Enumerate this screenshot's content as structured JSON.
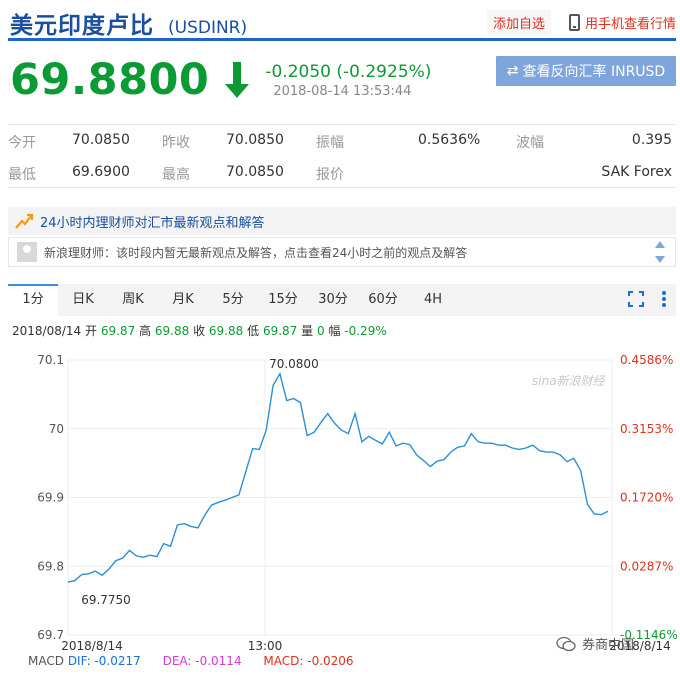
{
  "header": {
    "pair_name": "美元印度卢比",
    "pair_code": "(USDINR)",
    "add_favorite": "添加自选",
    "mobile_view": "用手机查看行情"
  },
  "quote": {
    "price": "69.8800",
    "change": "-0.2050 (-0.2925%)",
    "time": "2018-08-14 13:53:44",
    "reverse_button": "查看反向汇率 INRUSD",
    "colors": {
      "down": "#0c9a34",
      "up": "#e0301e",
      "brand": "#1a4ea0"
    }
  },
  "stats": {
    "row1": [
      {
        "label": "今开",
        "value": "70.0850"
      },
      {
        "label": "昨收",
        "value": "70.0850"
      },
      {
        "label": "振幅",
        "value": "0.5636%"
      },
      {
        "label": "波幅",
        "value": "0.395"
      }
    ],
    "row2": [
      {
        "label": "最低",
        "value": "69.6900"
      },
      {
        "label": "最高",
        "value": "70.0850"
      },
      {
        "label": "报价",
        "value": ""
      },
      {
        "label": "",
        "value": "SAK Forex"
      }
    ]
  },
  "expert": {
    "title": "24小时内理财师对汇市最新观点和解答",
    "message": "新浪理财师：该时段内暂无最新观点及解答，点击查看24小时之前的观点及解答"
  },
  "tabs": [
    "1分",
    "日K",
    "周K",
    "月K",
    "5分",
    "15分",
    "30分",
    "60分",
    "4H"
  ],
  "active_tab": "1分",
  "ohlc": {
    "date": "2018/08/14",
    "open_label": "开",
    "open": "69.87",
    "high_label": "高",
    "high": "69.88",
    "close_label": "收",
    "close": "69.88",
    "low_label": "低",
    "low": "69.87",
    "volume_label": "量",
    "volume": "0",
    "amp_label": "幅",
    "amp": "-0.29%"
  },
  "watermark": "sina新浪财经",
  "wechat_label": "券商中国",
  "macd": {
    "label": "MACD",
    "dif": "DIF: -0.0217",
    "dea": "DEA: -0.0114",
    "macd": "MACD: -0.0206"
  },
  "chart_data": {
    "type": "line",
    "x_ticks": [
      "2018/8/14",
      "13:00",
      "2018/8/14"
    ],
    "y_ticks": [
      "70.1",
      "70",
      "69.9",
      "69.8",
      "69.7"
    ],
    "pct_ticks": [
      "0.4586%",
      "0.3153%",
      "0.1720%",
      "0.0287%",
      "-0.1146%"
    ],
    "ylim": [
      69.7,
      70.1
    ],
    "annotations": [
      {
        "text": "70.0800",
        "index": 31
      },
      {
        "text": "69.7750",
        "index": 0
      }
    ],
    "grid": true,
    "series": [
      {
        "values": [
          69.777,
          69.779,
          69.788,
          69.789,
          69.793,
          69.787,
          69.796,
          69.808,
          69.812,
          69.823,
          69.815,
          69.813,
          69.816,
          69.814,
          69.833,
          69.829,
          69.86,
          69.862,
          69.858,
          69.856,
          69.874,
          69.889,
          69.893,
          69.896,
          69.9,
          69.904,
          69.937,
          69.971,
          69.97,
          69.998,
          70.063,
          70.08,
          70.041,
          70.044,
          70.038,
          69.99,
          69.995,
          70.009,
          70.022,
          70.008,
          69.998,
          69.993,
          70.022,
          69.981,
          69.989,
          69.983,
          69.978,
          69.995,
          69.975,
          69.979,
          69.977,
          69.962,
          69.954,
          69.945,
          69.953,
          69.955,
          69.966,
          69.973,
          69.975,
          69.993,
          69.981,
          69.979,
          69.979,
          69.976,
          69.976,
          69.972,
          69.97,
          69.972,
          69.976,
          69.968,
          69.966,
          69.966,
          69.962,
          69.952,
          69.957,
          69.939,
          69.89,
          69.876,
          69.875,
          69.88
        ]
      }
    ]
  }
}
